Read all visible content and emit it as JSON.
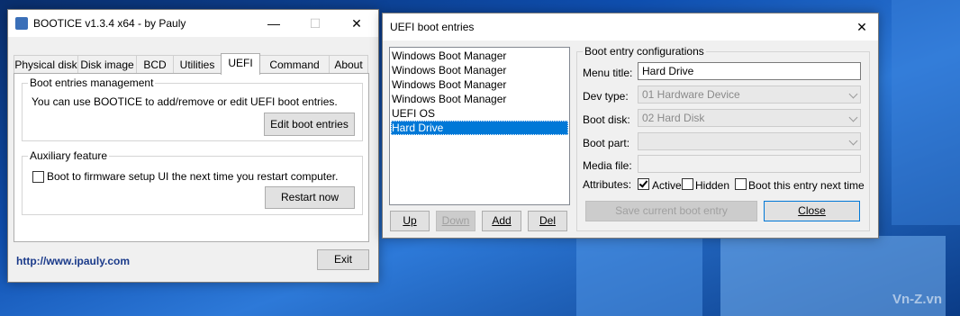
{
  "bootice": {
    "title": "BOOTICE v1.3.4 x64 - by Pauly",
    "minimize_icon": "minimize-icon",
    "maximize_icon": "maximize-icon",
    "close_icon": "close-icon",
    "tabs": [
      {
        "label": "Physical disk"
      },
      {
        "label": "Disk image"
      },
      {
        "label": "BCD"
      },
      {
        "label": "Utilities"
      },
      {
        "label": "UEFI",
        "active": true
      },
      {
        "label": "Command line"
      },
      {
        "label": "About"
      }
    ],
    "boot_entries_group": "Boot entries management",
    "boot_entries_desc": "You can use BOOTICE to add/remove or edit UEFI boot entries.",
    "edit_button": "Edit boot entries",
    "aux_group": "Auxiliary feature",
    "firmware_checkbox_label": "Boot to firmware setup UI the next time you restart computer.",
    "firmware_checked": false,
    "restart_button": "Restart now",
    "website": "http://www.ipauly.com",
    "exit_button": "Exit"
  },
  "uefi": {
    "title": "UEFI boot entries",
    "close_icon": "close-icon",
    "entries": [
      "Windows Boot Manager",
      "Windows Boot Manager",
      "Windows Boot Manager",
      "Windows Boot Manager",
      "UEFI OS",
      "Hard Drive"
    ],
    "selected_index": 5,
    "up_button": "Up",
    "down_button": "Down",
    "add_button": "Add",
    "del_button": "Del",
    "config_group": "Boot entry configurations",
    "menu_title_label": "Menu title:",
    "menu_title_value": "Hard Drive",
    "dev_type_label": "Dev type:",
    "dev_type_value": "01  Hardware Device",
    "boot_disk_label": "Boot disk:",
    "boot_disk_value": "02  Hard Disk",
    "boot_part_label": "Boot part:",
    "boot_part_value": "",
    "media_file_label": "Media file:",
    "media_file_value": "",
    "attributes_label": "Attributes:",
    "active_label": "Active",
    "active_checked": true,
    "hidden_label": "Hidden",
    "hidden_checked": false,
    "next_time_label": "Boot this entry next time",
    "next_time_checked": false,
    "save_button": "Save current boot entry",
    "close_button": "Close"
  },
  "watermark": "Vn-Z.vn",
  "colors": {
    "selection": "#0078d7",
    "link": "#1a3a8a",
    "desktop": "#0f4fb0"
  }
}
